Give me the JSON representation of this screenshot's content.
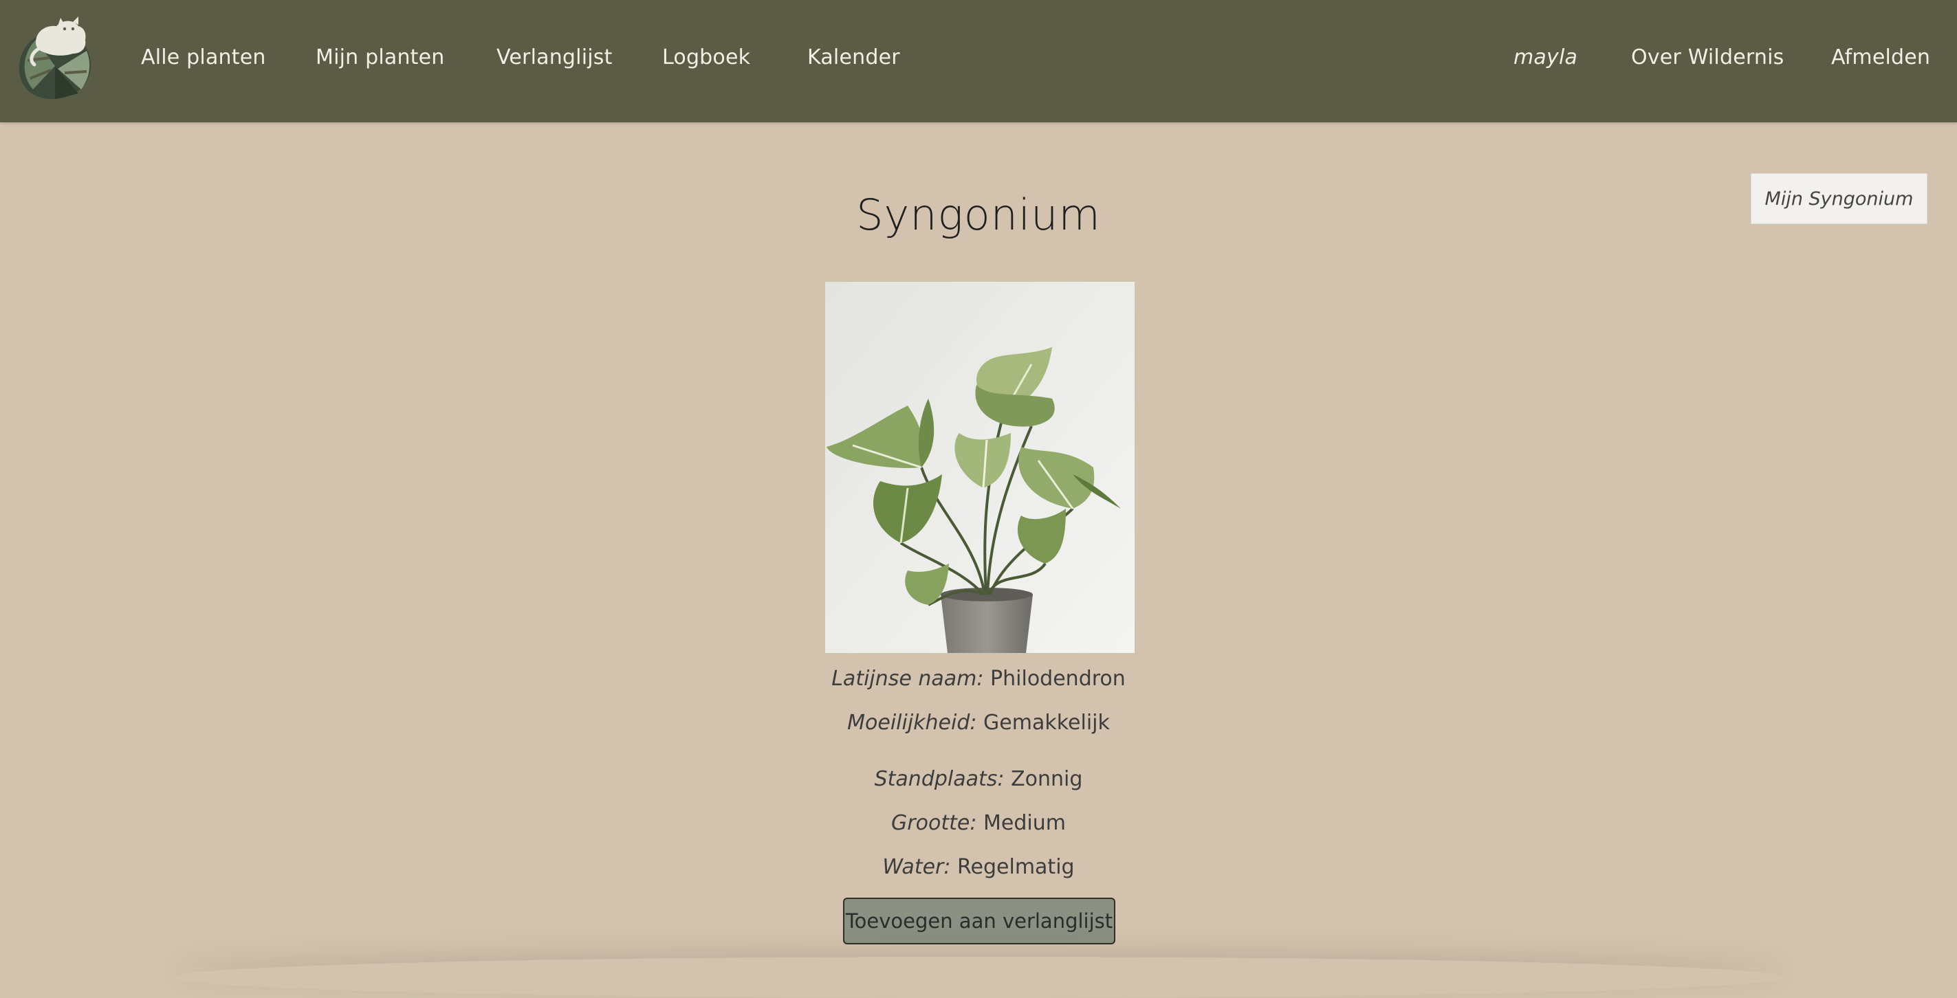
{
  "nav": {
    "links": [
      "Alle planten",
      "Mijn planten",
      "Verlanglijst",
      "Logboek",
      "Kalender"
    ],
    "user": "mayla",
    "about": "Over Wildernis",
    "logout": "Afmelden"
  },
  "my_plant_button": "Mijn Syngonium",
  "plant": {
    "title": "Syngonium",
    "details": [
      {
        "label": "Latijnse naam:",
        "value": "Philodendron"
      },
      {
        "label": "Moeilijkheid:",
        "value": "Gemakkelijk"
      },
      {
        "label": "Standplaats:",
        "value": "Zonnig"
      },
      {
        "label": "Grootte:",
        "value": "Medium"
      },
      {
        "label": "Water:",
        "value": "Regelmatig"
      }
    ]
  },
  "wishlist_button": "Toevoegen aan verlanglijst",
  "colors": {
    "header": "#5b5c45",
    "background": "#d3c3ae",
    "button": "#8a9082"
  },
  "icons": {
    "logo": "leopard-on-monstera-leaf-logo"
  }
}
